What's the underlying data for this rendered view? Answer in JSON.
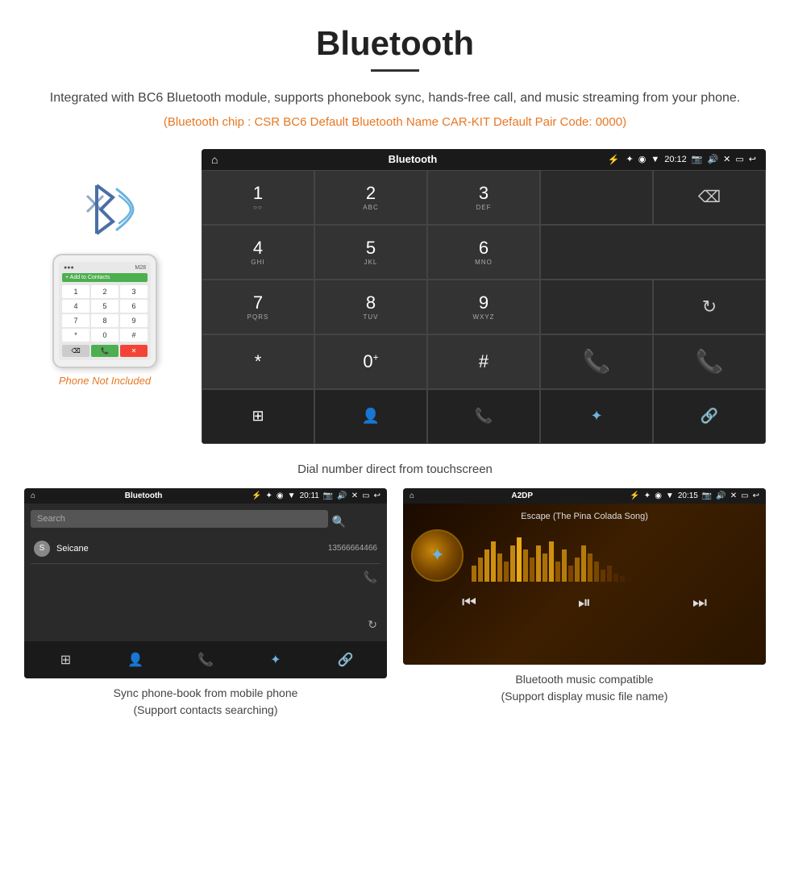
{
  "title": "Bluetooth",
  "underline": true,
  "subtitle": "Integrated with BC6 Bluetooth module, supports phonebook sync, hands-free call, and music streaming from your phone.",
  "orange_info": "(Bluetooth chip : CSR BC6    Default Bluetooth Name CAR-KIT    Default Pair Code: 0000)",
  "phone_label": "Phone Not Included",
  "dial_caption": "Dial number direct from touchscreen",
  "screen1": {
    "title": "Bluetooth",
    "time": "20:12",
    "keys": [
      "1",
      "2",
      "3",
      "4",
      "5",
      "6",
      "7",
      "8",
      "9",
      "*",
      "0+",
      "#"
    ],
    "key_subs": [
      "",
      "ABC",
      "DEF",
      "GHI",
      "JKL",
      "MNO",
      "PQRS",
      "TUV",
      "WXYZ",
      "",
      "",
      ""
    ]
  },
  "phonebook_screen": {
    "title": "Bluetooth",
    "time": "20:11",
    "search_placeholder": "Search",
    "contact": {
      "letter": "S",
      "name": "Seicane",
      "number": "13566664466"
    }
  },
  "music_screen": {
    "title": "A2DP",
    "time": "20:15",
    "song_title": "Escape (The Pina Colada Song)"
  },
  "caption_phonebook": "Sync phone-book from mobile phone\n(Support contacts searching)",
  "caption_music": "Bluetooth music compatible\n(Support display music file name)"
}
